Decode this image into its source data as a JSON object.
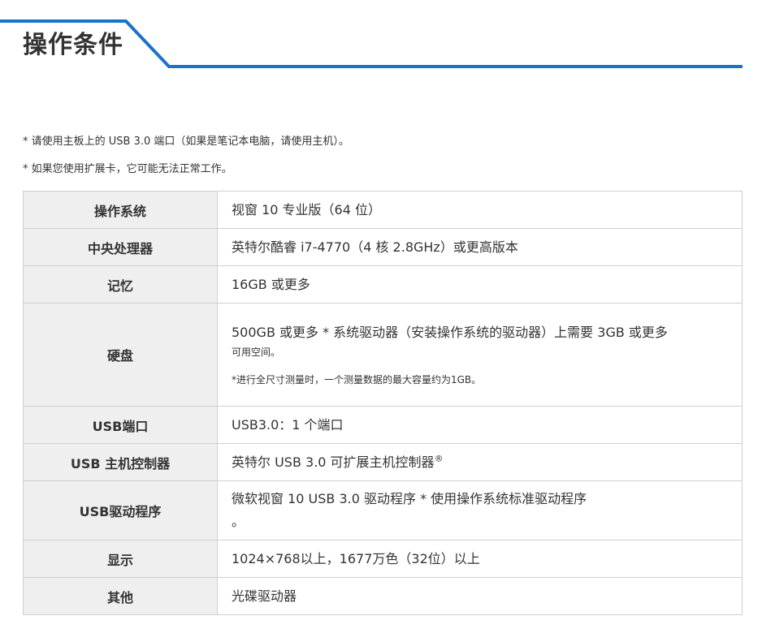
{
  "page": {
    "title": "操作条件",
    "accent_color": "#1a73c8"
  },
  "notes": [
    "* 请使用主板上的 USB 3.0 端口（如果是笔记本电脑，请使用主机）。",
    "* 如果您使用扩展卡，它可能无法正常工作。"
  ],
  "specs": {
    "os": {
      "label": "操作系统",
      "value": "视窗 10 专业版（64 位）"
    },
    "cpu": {
      "label": "中央处理器",
      "value": "英特尔酷睿 i7-4770（4 核 2.8GHz）或更高版本"
    },
    "memory": {
      "label": "记忆",
      "value": "16GB 或更多"
    },
    "disk": {
      "label": "硬盘",
      "value_line1": "500GB 或更多 * 系统驱动器（安装操作系统的驱动器）上需要 3GB 或更多",
      "value_line2": "可用空间。",
      "note": "*进行全尺寸测量时，一个测量数据的最大容量约为1GB。"
    },
    "usb_port": {
      "label": "USB端口",
      "value": "USB3.0：1 个端口"
    },
    "usb_controller": {
      "label": "USB 主机控制器",
      "value": "英特尔 USB 3.0 可扩展主机控制器",
      "mark": "®"
    },
    "usb_driver": {
      "label": "USB驱动程序",
      "value_line1": "微软视窗 10 USB 3.0 驱动程序 * 使用操作系统标准驱动程序",
      "value_line2": "。"
    },
    "display": {
      "label": "显示",
      "value": "1024×768以上，1677万色（32位）以上"
    },
    "other": {
      "label": "其他",
      "value": "光碟驱动器"
    }
  }
}
